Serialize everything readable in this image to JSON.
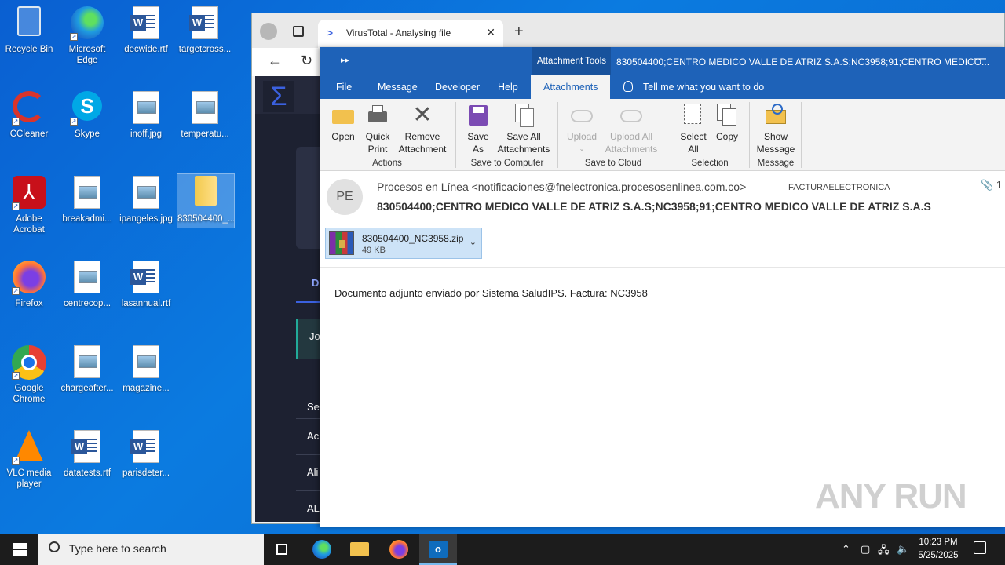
{
  "desktop": {
    "icons": [
      {
        "label": "Recycle Bin"
      },
      {
        "label": "Microsoft Edge"
      },
      {
        "label": "decwide.rtf"
      },
      {
        "label": "targetcross..."
      },
      {
        "label": "CCleaner"
      },
      {
        "label": "Skype"
      },
      {
        "label": "inoff.jpg"
      },
      {
        "label": "temperatu..."
      },
      {
        "label": "Adobe Acrobat"
      },
      {
        "label": "breakadmi..."
      },
      {
        "label": "ipangeles.jpg"
      },
      {
        "label": "830504400_..."
      },
      {
        "label": "Firefox"
      },
      {
        "label": "centrecop..."
      },
      {
        "label": "lasannual.rtf"
      },
      {
        "label": "Google Chrome"
      },
      {
        "label": "chargeafter..."
      },
      {
        "label": "magazine..."
      },
      {
        "label": "VLC media player"
      },
      {
        "label": "datatests.rtf"
      },
      {
        "label": "parisdeter..."
      }
    ]
  },
  "browser": {
    "tab_title": "VirusTotal - Analysing file",
    "vt_tab": "D",
    "vt_link": "Jo",
    "vt_section": "Se",
    "vt_rows": [
      "Ac",
      "Ali",
      "AL"
    ]
  },
  "outlook": {
    "context_tab": "Attachment Tools",
    "window_title": "830504400;CENTRO MEDICO VALLE DE ATRIZ S.A.S;NC3958;91;CENTRO MEDICO...",
    "menu": [
      "File",
      "Message",
      "Developer",
      "Help",
      "Attachments"
    ],
    "tell_me": "Tell me what you want to do",
    "ribbon": {
      "open": "Open",
      "quick_print": "Quick Print",
      "remove_attachment": "Remove Attachment",
      "actions_label": "Actions",
      "save_as": "Save As",
      "save_all": "Save All Attachments",
      "save_computer_label": "Save to Computer",
      "upload": "Upload",
      "upload_all": "Upload All Attachments",
      "save_cloud_label": "Save to Cloud",
      "select_all": "Select All",
      "copy": "Copy",
      "selection_label": "Selection",
      "show_message": "Show Message",
      "message_label": "Message"
    },
    "avatar_initials": "PE",
    "from": "Procesos en Línea <notificaciones@fnelectronica.procesosenlinea.com.co>",
    "to": "FACTURAELECTRONICA",
    "attachment_count": "1",
    "subject": "830504400;CENTRO MEDICO VALLE DE ATRIZ S.A.S;NC3958;91;CENTRO MEDICO VALLE DE ATRIZ S.A.S",
    "attachment": {
      "name": "830504400_NC3958.zip",
      "size": "49 KB"
    },
    "body": "Documento adjunto enviado por Sistema SaludIPS. Factura: NC3958"
  },
  "watermark": "ANY RUN",
  "taskbar": {
    "search_placeholder": "Type here to search",
    "time": "10:23 PM",
    "date": "5/25/2025"
  }
}
